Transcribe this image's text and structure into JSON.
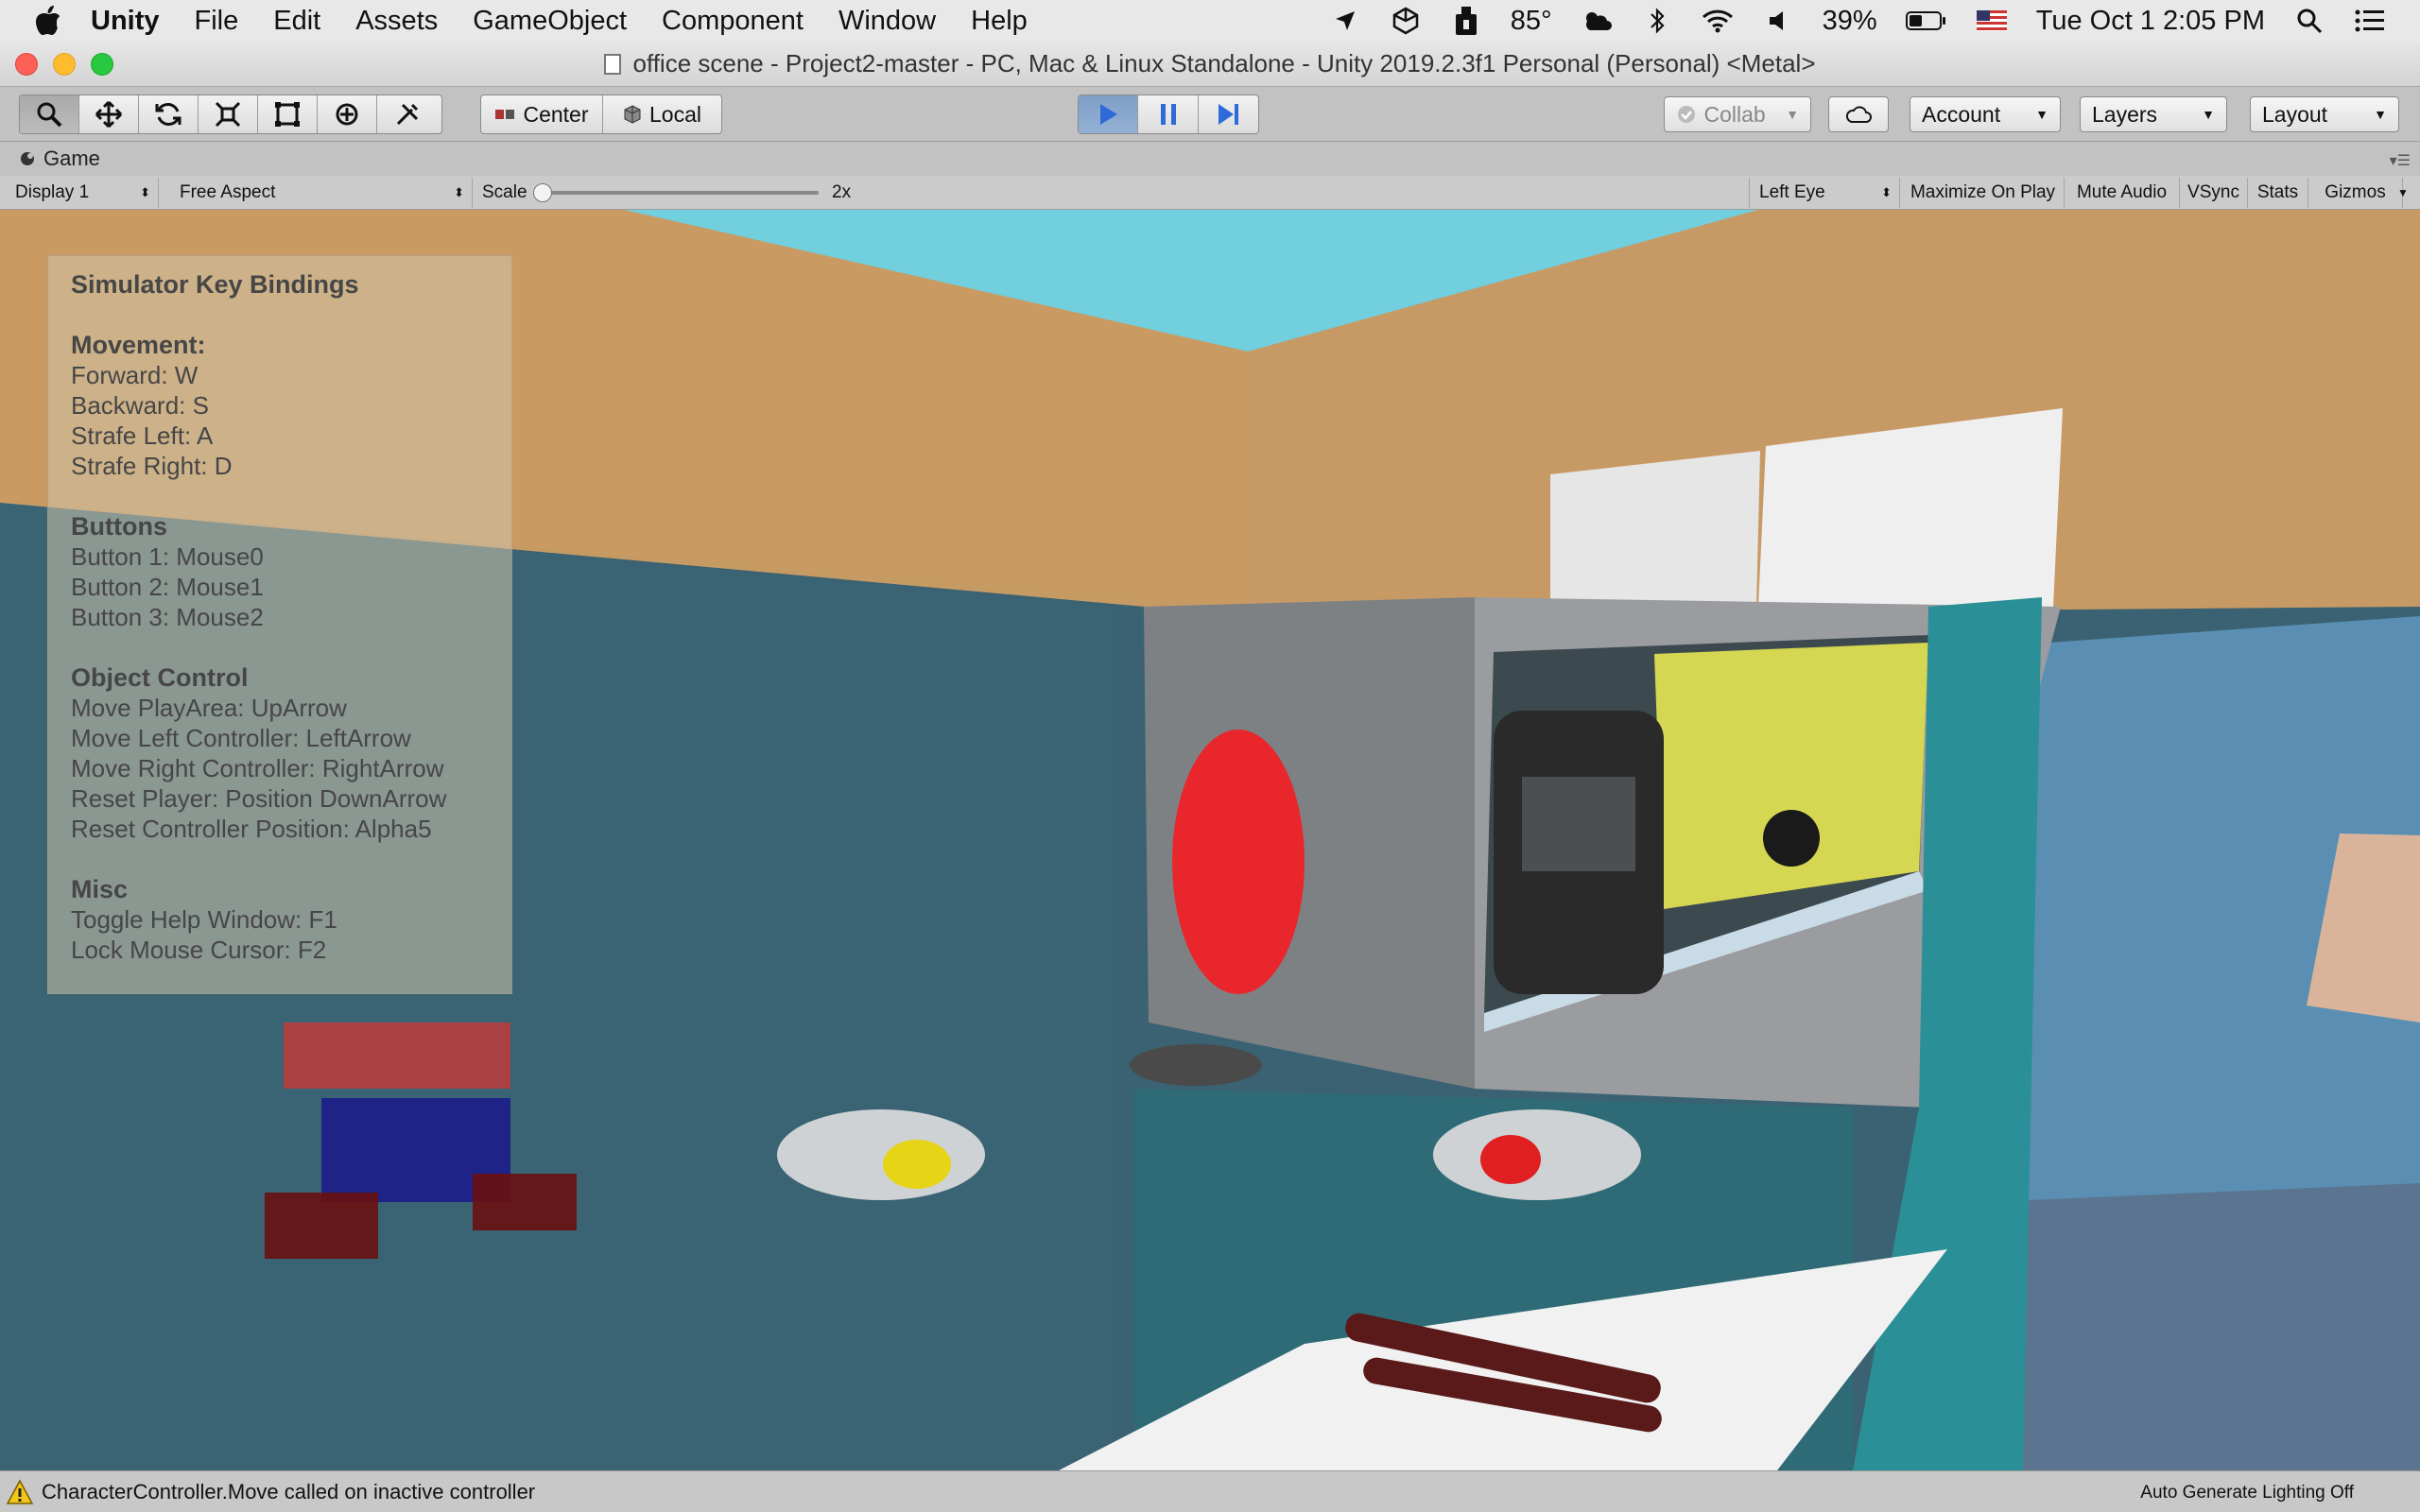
{
  "menubar": {
    "app_name": "Unity",
    "items": [
      "File",
      "Edit",
      "Assets",
      "GameObject",
      "Component",
      "Window",
      "Help"
    ],
    "temperature": "85°",
    "battery": "39%",
    "clock": "Tue Oct 1  2:05 PM"
  },
  "window": {
    "title": "office scene - Project2-master - PC, Mac & Linux Standalone - Unity 2019.2.3f1 Personal (Personal) <Metal>"
  },
  "toolbar": {
    "tools": [
      "hand-tool",
      "move-tool",
      "rotate-tool",
      "scale-tool",
      "rect-tool",
      "transform-tool",
      "custom-tool"
    ],
    "pivot_label": "Center",
    "space_label": "Local",
    "collab_label": "Collab",
    "account_label": "Account",
    "layers_label": "Layers",
    "layout_label": "Layout"
  },
  "game_tab": {
    "title": "Game"
  },
  "game_bar": {
    "display": "Display 1",
    "aspect": "Free Aspect",
    "scale_label": "Scale",
    "scale_value": "2x",
    "eye": "Left Eye",
    "toggles": [
      "Maximize On Play",
      "Mute Audio",
      "VSync",
      "Stats",
      "Gizmos"
    ]
  },
  "help": {
    "title": "Simulator Key Bindings",
    "sections": [
      {
        "heading": "Movement:",
        "lines": [
          "Forward: W",
          "Backward: S",
          "Strafe Left: A",
          "Strafe Right: D"
        ]
      },
      {
        "heading": "Buttons",
        "lines": [
          "Button 1: Mouse0",
          "Button 2: Mouse1",
          "Button 3: Mouse2"
        ]
      },
      {
        "heading": "Object Control",
        "lines": [
          "Move PlayArea: UpArrow",
          "Move Left Controller: LeftArrow",
          "Move Right Controller: RightArrow",
          "Reset Player: Position DownArrow",
          "Reset Controller Position: Alpha5"
        ]
      },
      {
        "heading": "Misc",
        "lines": [
          "Toggle Help Window: F1",
          "Lock Mouse Cursor: F2"
        ]
      }
    ]
  },
  "statusbar": {
    "message": "CharacterController.Move called on inactive controller",
    "lighting": "Auto Generate Lighting Off"
  },
  "colors": {
    "play_active": "#4a7bd0",
    "wall_orange": "#c69a63",
    "wall_teal": "#3b6473",
    "sky": "#71cfde"
  }
}
